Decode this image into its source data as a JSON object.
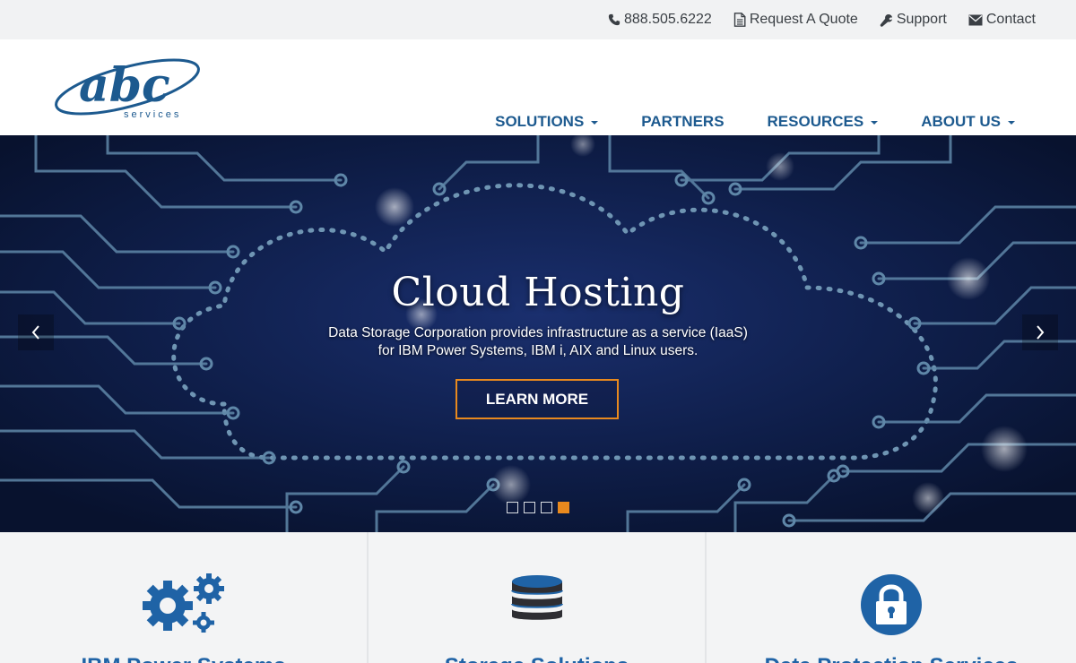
{
  "topbar": {
    "phone": "888.505.6222",
    "quote": "Request A Quote",
    "support": "Support",
    "contact": "Contact"
  },
  "logo": {
    "brand": "abc",
    "tagline": "services"
  },
  "nav": [
    {
      "label": "SOLUTIONS",
      "dropdown": true
    },
    {
      "label": "PARTNERS",
      "dropdown": false
    },
    {
      "label": "RESOURCES",
      "dropdown": true
    },
    {
      "label": "ABOUT US",
      "dropdown": true
    }
  ],
  "hero": {
    "title": "Cloud Hosting",
    "subtitle_line1": "Data Storage Corporation provides infrastructure as a service (IaaS)",
    "subtitle_line2": "for IBM Power Systems, IBM i, AIX and Linux users.",
    "button": "LEARN MORE",
    "slide_count": 4,
    "active_slide": 4
  },
  "features": [
    {
      "title": "IBM Power Systems",
      "icon": "gears-icon"
    },
    {
      "title": "Storage Solutions",
      "icon": "database-icon"
    },
    {
      "title": "Data Protection Services",
      "icon": "lock-icon"
    }
  ],
  "colors": {
    "brand_blue": "#1d5a8f",
    "accent_orange": "#e8891e",
    "topbar_bg": "#f1f2f3",
    "hero_bg": "#0b1a3c"
  }
}
